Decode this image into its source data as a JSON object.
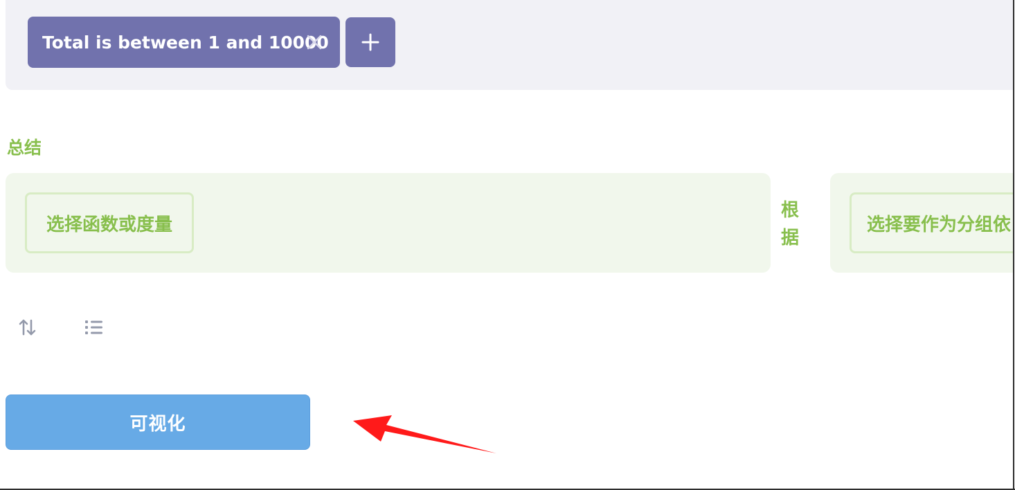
{
  "filter": {
    "pill_label": "Total is between 1 and 10000",
    "close_icon": "close-icon",
    "add_icon": "plus-icon"
  },
  "summarize": {
    "section_label": "总结",
    "metric_button_label": "选择函数或度量",
    "by_label": "根据",
    "group_button_label": "选择要作为分组依"
  },
  "actions": {
    "sort_icon": "sort-icon",
    "limit_icon": "list-icon"
  },
  "visualize": {
    "button_label": "可视化"
  },
  "colors": {
    "filter_accent": "#7172ad",
    "filter_panel_bg": "#f1f1f6",
    "summarize_accent": "#88bf4d",
    "summarize_panel_bg": "#f1f7ec",
    "visualize_bg": "#67aae6",
    "annotation_arrow": "#ff1a1a"
  }
}
